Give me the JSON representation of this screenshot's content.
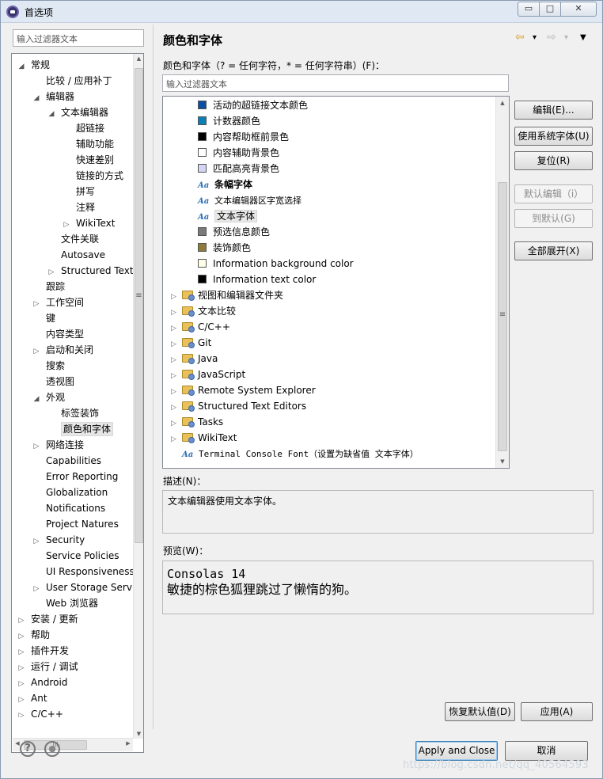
{
  "window": {
    "title": "首选项",
    "min": "▭",
    "max": "□",
    "close": "✕"
  },
  "left": {
    "filter_placeholder": "输入过滤器文本",
    "tree": [
      {
        "label": "常规",
        "depth": 0,
        "arrow": "◢"
      },
      {
        "label": "比较 / 应用补丁",
        "depth": 1,
        "arrow": ""
      },
      {
        "label": "编辑器",
        "depth": 1,
        "arrow": "◢"
      },
      {
        "label": "文本编辑器",
        "depth": 2,
        "arrow": "◢"
      },
      {
        "label": "超链接",
        "depth": 3,
        "arrow": ""
      },
      {
        "label": "辅助功能",
        "depth": 3,
        "arrow": ""
      },
      {
        "label": "快速差别",
        "depth": 3,
        "arrow": ""
      },
      {
        "label": "链接的方式",
        "depth": 3,
        "arrow": ""
      },
      {
        "label": "拼写",
        "depth": 3,
        "arrow": ""
      },
      {
        "label": "注释",
        "depth": 3,
        "arrow": ""
      },
      {
        "label": "WikiText",
        "depth": 3,
        "arrow": "▷"
      },
      {
        "label": "文件关联",
        "depth": 2,
        "arrow": ""
      },
      {
        "label": "Autosave",
        "depth": 2,
        "arrow": ""
      },
      {
        "label": "Structured Text",
        "depth": 2,
        "arrow": "▷"
      },
      {
        "label": "跟踪",
        "depth": 1,
        "arrow": ""
      },
      {
        "label": "工作空间",
        "depth": 1,
        "arrow": "▷"
      },
      {
        "label": "键",
        "depth": 1,
        "arrow": ""
      },
      {
        "label": "内容类型",
        "depth": 1,
        "arrow": ""
      },
      {
        "label": "启动和关闭",
        "depth": 1,
        "arrow": "▷"
      },
      {
        "label": "搜索",
        "depth": 1,
        "arrow": ""
      },
      {
        "label": "透视图",
        "depth": 1,
        "arrow": ""
      },
      {
        "label": "外观",
        "depth": 1,
        "arrow": "◢"
      },
      {
        "label": "标签装饰",
        "depth": 2,
        "arrow": ""
      },
      {
        "label": "颜色和字体",
        "depth": 2,
        "arrow": "",
        "selected": true
      },
      {
        "label": "网络连接",
        "depth": 1,
        "arrow": "▷"
      },
      {
        "label": "Capabilities",
        "depth": 1,
        "arrow": ""
      },
      {
        "label": "Error Reporting",
        "depth": 1,
        "arrow": ""
      },
      {
        "label": "Globalization",
        "depth": 1,
        "arrow": ""
      },
      {
        "label": "Notifications",
        "depth": 1,
        "arrow": ""
      },
      {
        "label": "Project Natures",
        "depth": 1,
        "arrow": ""
      },
      {
        "label": "Security",
        "depth": 1,
        "arrow": "▷"
      },
      {
        "label": "Service Policies",
        "depth": 1,
        "arrow": ""
      },
      {
        "label": "UI Responsiveness",
        "depth": 1,
        "arrow": ""
      },
      {
        "label": "User Storage Service",
        "depth": 1,
        "arrow": "▷"
      },
      {
        "label": "Web 浏览器",
        "depth": 1,
        "arrow": ""
      },
      {
        "label": "安装 / 更新",
        "depth": 0,
        "arrow": "▷"
      },
      {
        "label": "帮助",
        "depth": 0,
        "arrow": "▷"
      },
      {
        "label": "插件开发",
        "depth": 0,
        "arrow": "▷"
      },
      {
        "label": "运行 / 调试",
        "depth": 0,
        "arrow": "▷"
      },
      {
        "label": "Android",
        "depth": 0,
        "arrow": "▷"
      },
      {
        "label": "Ant",
        "depth": 0,
        "arrow": "▷"
      },
      {
        "label": "C/C++",
        "depth": 0,
        "arrow": "▷"
      }
    ],
    "hscroll_grip": "III",
    "vscroll_grip": "≡"
  },
  "right": {
    "title": "颜色和字体",
    "nav_back": "⇦",
    "nav_forward": "⇨",
    "nav_dropdown": "▾",
    "nav_menu": "▼",
    "section_label": "颜色和字体（? = 任何字符，* = 任何字符串）(F)：",
    "filter_placeholder": "输入过滤器文本",
    "items": [
      {
        "kind": "color",
        "label": "活动的超链接文本颜色",
        "color": "#0b4fa3"
      },
      {
        "kind": "color",
        "label": "计数器颜色",
        "color": "#0a7fb5"
      },
      {
        "kind": "color",
        "label": "内容帮助框前景色",
        "color": "#000000"
      },
      {
        "kind": "color",
        "label": "内容辅助背景色",
        "color": "#ffffff"
      },
      {
        "kind": "color",
        "label": "匹配高亮背景色",
        "color": "#d4d4f4"
      },
      {
        "kind": "font",
        "label": "条幅字体",
        "style": "bold"
      },
      {
        "kind": "font",
        "label": "文本编辑器区字宽选择",
        "style": "mono"
      },
      {
        "kind": "font",
        "label": "文本字体",
        "style": "plain",
        "selected": true
      },
      {
        "kind": "color",
        "label": "预选信息颜色",
        "color": "#7a7a7a"
      },
      {
        "kind": "color",
        "label": "装饰颜色",
        "color": "#8e7b3a"
      },
      {
        "kind": "color",
        "label": "Information background color",
        "color": "#fffee6"
      },
      {
        "kind": "color",
        "label": "Information text color",
        "color": "#000000"
      },
      {
        "kind": "folder",
        "label": "视图和编辑器文件夹"
      },
      {
        "kind": "folder",
        "label": "文本比较"
      },
      {
        "kind": "folder",
        "label": "C/C++"
      },
      {
        "kind": "folder",
        "label": "Git"
      },
      {
        "kind": "folder",
        "label": "Java"
      },
      {
        "kind": "folder",
        "label": "JavaScript"
      },
      {
        "kind": "folder",
        "label": "Remote System Explorer"
      },
      {
        "kind": "folder",
        "label": "Structured Text Editors"
      },
      {
        "kind": "folder",
        "label": "Tasks"
      },
      {
        "kind": "folder",
        "label": "WikiText"
      },
      {
        "kind": "font",
        "label": "Terminal Console Font（设置为缺省值 文本字体）",
        "style": "mono",
        "top": true
      }
    ],
    "aa_glyph": "Aa",
    "buttons": [
      {
        "label": "编辑(E)...",
        "enabled": true
      },
      {
        "label": "使用系统字体(U)",
        "enabled": true
      },
      {
        "label": "复位(R)",
        "enabled": true
      },
      {
        "label": "默认编辑（i）",
        "enabled": false
      },
      {
        "label": "到默认(G)",
        "enabled": false
      },
      {
        "label": "全部展开(X)",
        "enabled": true
      }
    ],
    "description_label": "描述(N)：",
    "description": "文本编辑器使用文本字体。",
    "preview_label": "预览(W)：",
    "preview_font": "Consolas 14",
    "preview_sample": "敏捷的棕色狐狸跳过了懒惰的狗。",
    "restore_defaults": "恢复默认值(D)",
    "apply": "应用(A)"
  },
  "footer": {
    "help_icon": "?",
    "import_icon": "●",
    "apply_close": "Apply and Close",
    "cancel": "取消"
  },
  "watermark": "https://blog.csdn.net/qq_40564593"
}
